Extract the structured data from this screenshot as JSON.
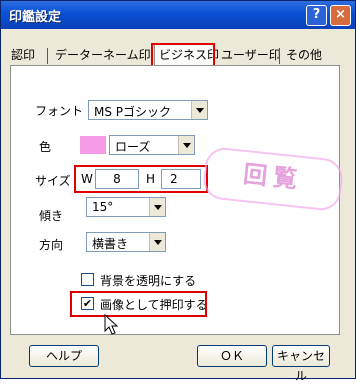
{
  "window": {
    "title": "印鑑設定",
    "help_glyph": "?",
    "close_glyph": "×"
  },
  "tabs": [
    {
      "label": "認印",
      "active": false
    },
    {
      "label": "データーネーム印",
      "active": false
    },
    {
      "label": "ビジネス印",
      "active": true
    },
    {
      "label": "ユーザー印",
      "active": false
    },
    {
      "label": "その他",
      "active": false
    }
  ],
  "form": {
    "font": {
      "label": "フォント",
      "value": "MS Pゴシック"
    },
    "color": {
      "label": "色",
      "value": "ローズ",
      "swatch_color": "#f59be6"
    },
    "size": {
      "label": "サイズ",
      "w_label": "W",
      "w_value": "8",
      "h_label": "H",
      "h_value": "2"
    },
    "tilt": {
      "label": "傾き",
      "value": "15°"
    },
    "direction": {
      "label": "方向",
      "value": "横書き"
    },
    "transparent_bg": {
      "label": "背景を透明にする",
      "checked": false
    },
    "print_as_image": {
      "label": "画像として押印する",
      "checked": true,
      "check_glyph": "✔"
    }
  },
  "stamp_preview": {
    "text": "回覧",
    "color": "#e07ad8"
  },
  "buttons": {
    "help": "ヘルプ",
    "ok": "ＯＫ",
    "cancel": "キャンセル"
  },
  "annotation_color": "#e00000"
}
